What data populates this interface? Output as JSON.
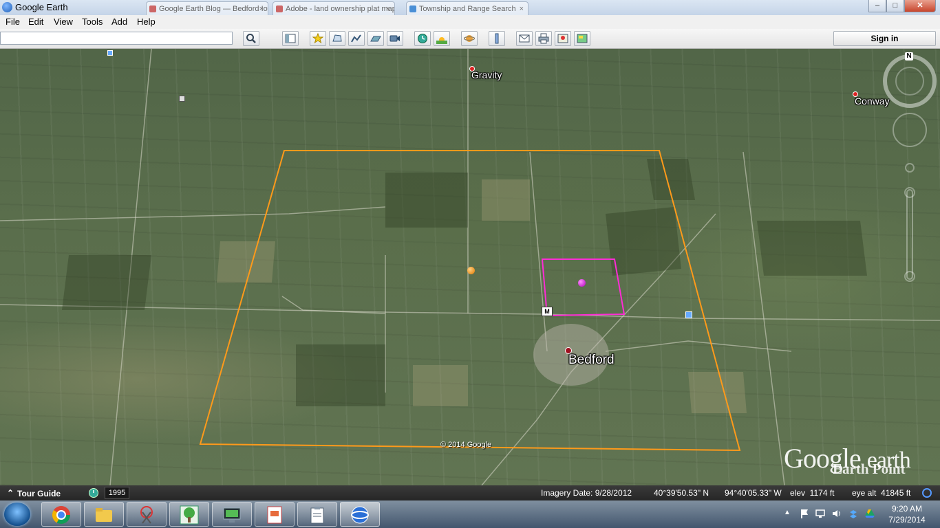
{
  "window": {
    "title": "Google Earth",
    "background_tabs": [
      {
        "label": "Google Earth Blog — Bedford Iowa"
      },
      {
        "label": "Adobe - land ownership plat maps"
      },
      {
        "label": "Township and Range Search"
      }
    ],
    "controls": {
      "minimize": "–",
      "maximize": "□",
      "close": "✕"
    }
  },
  "menubar": {
    "items": [
      {
        "label": "File"
      },
      {
        "label": "Edit"
      },
      {
        "label": "View"
      },
      {
        "label": "Tools"
      },
      {
        "label": "Add"
      },
      {
        "label": "Help"
      }
    ]
  },
  "toolbar": {
    "search_value": "",
    "search_placeholder": "",
    "buttons": [
      {
        "name": "search-button",
        "icon": "magnifier-icon"
      },
      {
        "name": "sidebar-toggle-button",
        "icon": "sidebar-icon"
      },
      {
        "name": "add-placemark-button",
        "icon": "placemark-icon"
      },
      {
        "name": "add-polygon-button",
        "icon": "polygon-icon"
      },
      {
        "name": "add-path-button",
        "icon": "path-icon"
      },
      {
        "name": "add-image-overlay-button",
        "icon": "image-overlay-icon"
      },
      {
        "name": "record-tour-button",
        "icon": "record-tour-icon"
      },
      {
        "name": "historical-imagery-button",
        "icon": "clock-icon"
      },
      {
        "name": "sunlight-button",
        "icon": "sun-icon"
      },
      {
        "name": "planets-button",
        "icon": "planet-icon"
      },
      {
        "name": "ruler-button",
        "icon": "ruler-icon"
      },
      {
        "name": "email-button",
        "icon": "envelope-icon"
      },
      {
        "name": "print-button",
        "icon": "printer-icon"
      },
      {
        "name": "view-in-maps-button",
        "icon": "maps-icon"
      },
      {
        "name": "save-image-button",
        "icon": "save-image-icon"
      }
    ],
    "sign_in_label": "Sign in"
  },
  "map": {
    "places": [
      {
        "label": "Gravity"
      },
      {
        "label": "Conway"
      },
      {
        "label": "Bedford"
      }
    ],
    "compass_letter": "N",
    "copyright": "© 2014 Google",
    "logo_google": "Google",
    "logo_earth": "earth",
    "logo_earth_point": "Earth Point",
    "overlay_colors": {
      "township": "#ff9a1a",
      "section": "#ff2bd6"
    }
  },
  "statusbar": {
    "tour_guide": "Tour Guide",
    "year": "1995",
    "imagery_date": "Imagery Date: 9/28/2012",
    "latitude": "40°39'50.53\" N",
    "longitude": "94°40'05.33\" W",
    "elevation": "elev  1174 ft",
    "eye_alt": "eye alt  41845 ft"
  },
  "taskbar": {
    "apps": [
      {
        "name": "chrome",
        "icon": "chrome-icon"
      },
      {
        "name": "explorer",
        "icon": "folder-icon"
      },
      {
        "name": "snipping-tool",
        "icon": "scissors-icon"
      },
      {
        "name": "family-tree",
        "icon": "tree-icon"
      },
      {
        "name": "media-manager",
        "icon": "monitor-icon"
      },
      {
        "name": "powerpoint",
        "icon": "presentation-icon"
      },
      {
        "name": "notes",
        "icon": "clipboard-icon"
      },
      {
        "name": "google-earth",
        "icon": "globe-icon"
      }
    ],
    "clock_time": "9:20 AM",
    "clock_date": "7/29/2014"
  }
}
